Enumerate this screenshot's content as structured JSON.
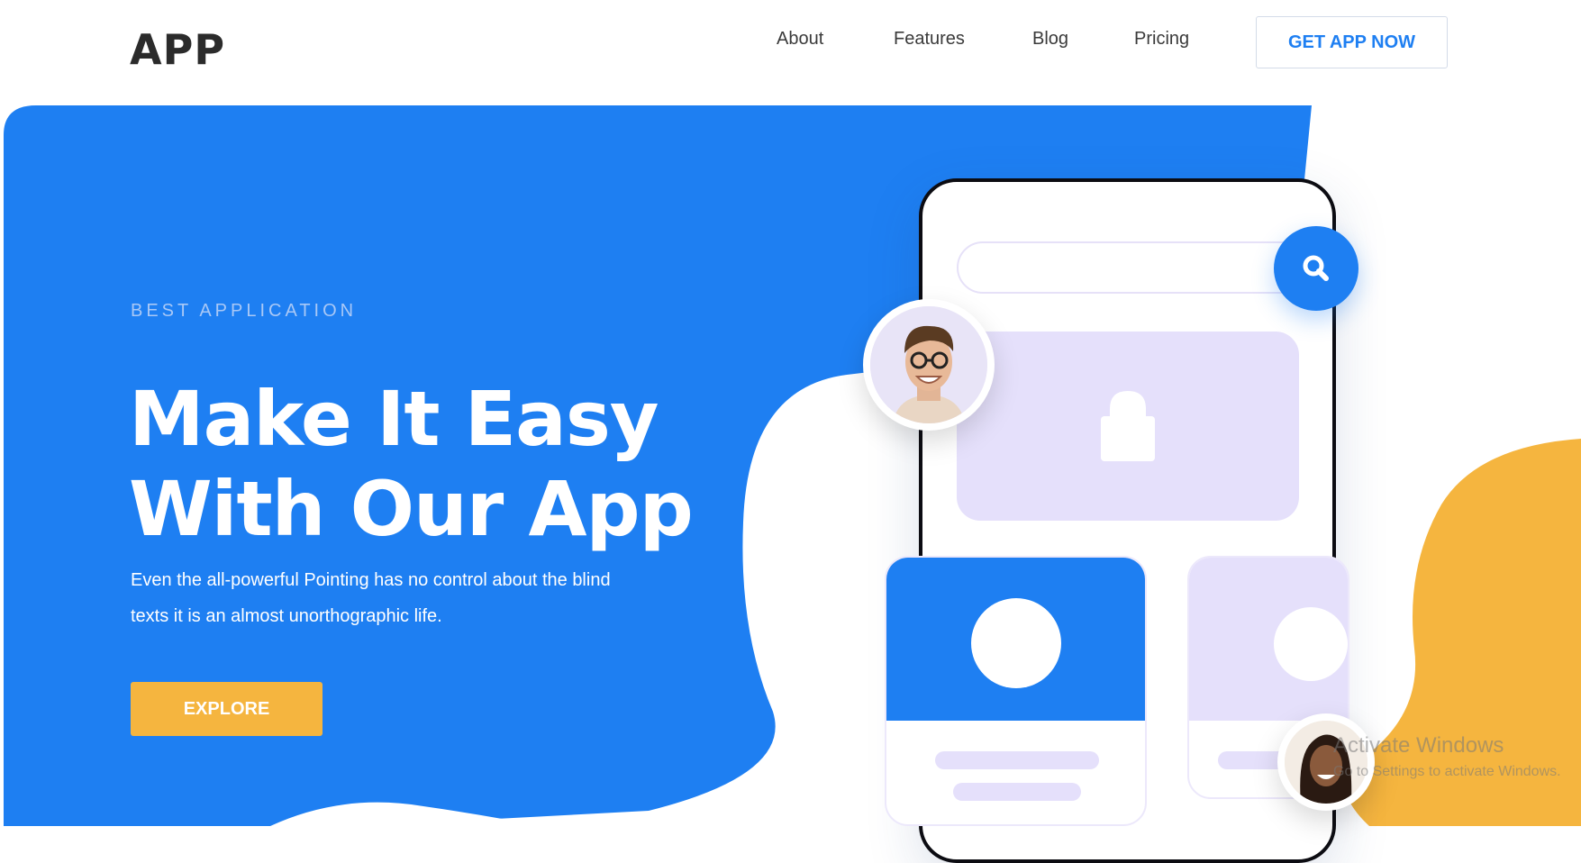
{
  "header": {
    "logo": "APP",
    "nav": [
      {
        "label": "About"
      },
      {
        "label": "Features"
      },
      {
        "label": "Blog"
      },
      {
        "label": "Pricing"
      }
    ],
    "cta_label": "GET APP NOW"
  },
  "hero": {
    "eyebrow": "BEST APPLICATION",
    "headline_line1": "Make It Easy",
    "headline_line2": "With Our App",
    "description_line1": "Even the all-powerful Pointing has no control about the blind",
    "description_line2": "texts it is an almost unorthographic life.",
    "button_label": "EXPLORE"
  },
  "watermark": {
    "title": "Activate Windows",
    "subtitle": "Go to Settings to activate Windows."
  },
  "colors": {
    "primary": "#1e7ff2",
    "accent": "#f5b53f",
    "lavender": "#e5e0fb",
    "text_dark": "#2b2b2b"
  },
  "icons": [
    "search-icon",
    "lock-icon",
    "avatar-man",
    "avatar-woman"
  ]
}
